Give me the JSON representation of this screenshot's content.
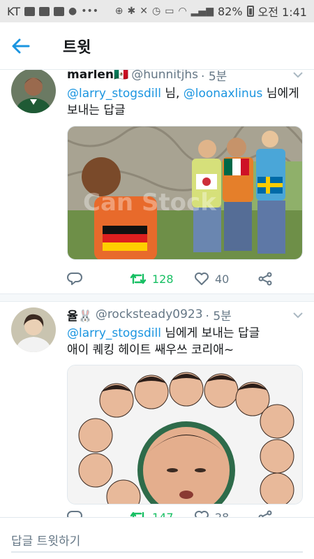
{
  "statusbar": {
    "carrier": "KT",
    "battery": "82%",
    "time": "오전 1:41"
  },
  "header": {
    "title": "트윗"
  },
  "tweets": [
    {
      "name": "marlen🇲🇽",
      "handle": "@hunnitjhs",
      "time": "· 5분",
      "mention1": "@larry_stogsdill",
      "between": " 님, ",
      "mention2": "@loonaxlinus",
      "reply_to_suffix": " 님에게",
      "text_line2": "보내는 답글",
      "media_watermark": "Can Stock",
      "retweets": "128",
      "likes": "40"
    },
    {
      "name": "율🐰",
      "handle": "@rocksteady0923",
      "time": "· 5분",
      "mention1": "@larry_stogsdill",
      "reply_to_suffix": " 님에게 보내는 답글",
      "text": "애이 퀘킹 헤이트 쌔우쓰 코리애~",
      "retweets": "147",
      "likes": "28"
    }
  ],
  "reply": {
    "placeholder": "답글 트윗하기"
  },
  "colors": {
    "accent": "#1b95e0",
    "retweet": "#17bf63",
    "muted": "#657786"
  }
}
